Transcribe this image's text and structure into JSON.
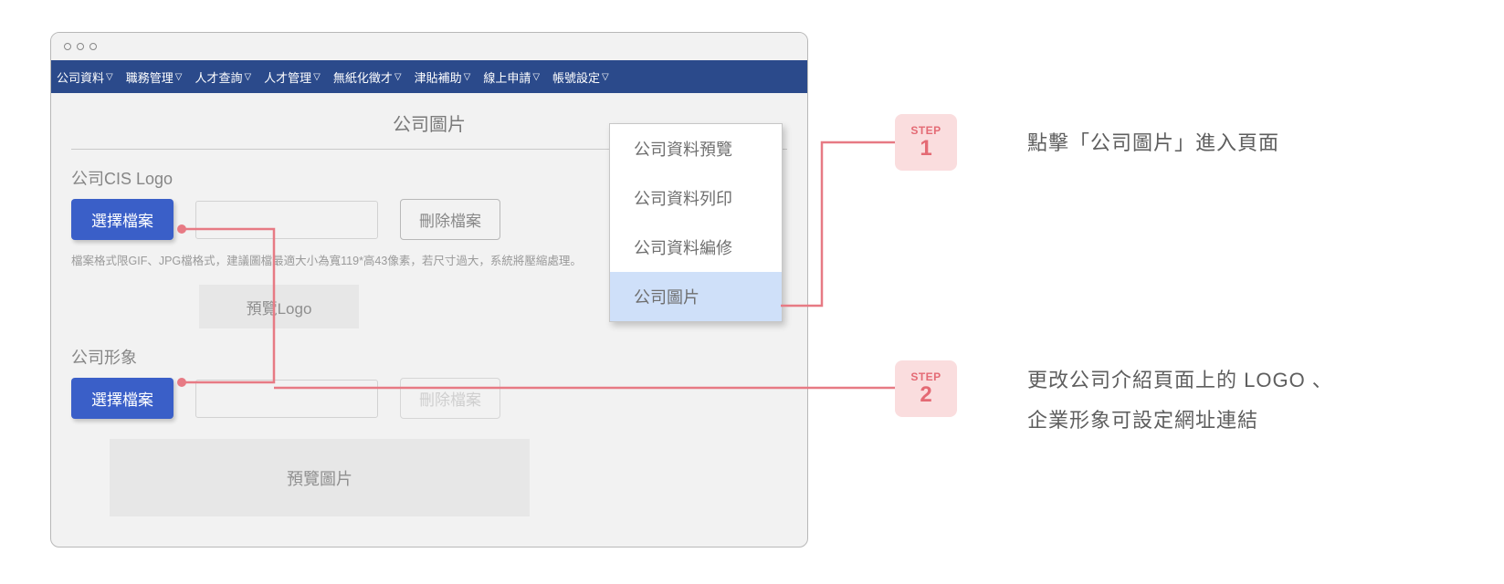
{
  "nav": {
    "items": [
      "公司資料",
      "職務管理",
      "人才查詢",
      "人才管理",
      "無紙化徵才",
      "津貼補助",
      "線上申請",
      "帳號設定"
    ]
  },
  "page_title": "公司圖片",
  "sections": {
    "cis": {
      "label": "公司CIS Logo",
      "choose": "選擇檔案",
      "delete": "刪除檔案",
      "hint": "檔案格式限GIF、JPG檔格式，建議圖檔最適大小為寬119*高43像素，若尺寸過大，系統將壓縮處理。",
      "preview": "預覽Logo"
    },
    "image": {
      "label": "公司形象",
      "choose": "選擇檔案",
      "delete": "刪除檔案",
      "preview": "預覽圖片"
    }
  },
  "dropdown": {
    "items": [
      "公司資料預覽",
      "公司資料列印",
      "公司資料編修",
      "公司圖片"
    ],
    "selected_index": 3
  },
  "steps": {
    "label": "STEP",
    "one": "1",
    "two": "2"
  },
  "captions": {
    "c1": "點擊「公司圖片」進入頁面",
    "c2_line1": "更改公司介紹頁面上的 LOGO 、",
    "c2_line2": "企業形象可設定網址連結"
  }
}
